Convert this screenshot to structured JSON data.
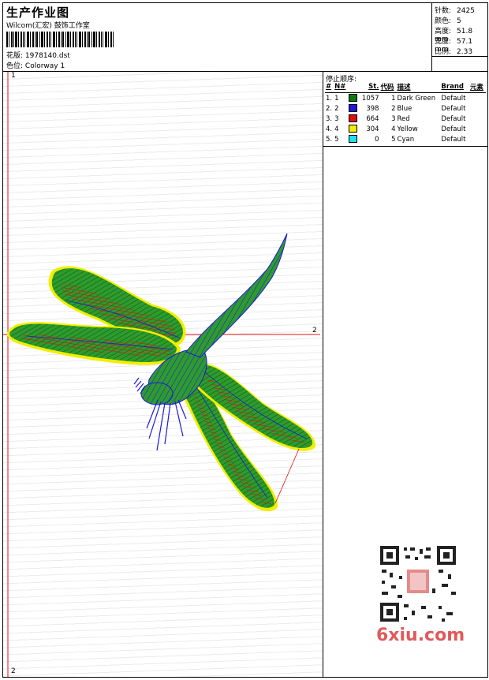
{
  "header": {
    "title": "生产作业图",
    "company": "Wilcom(汇宏) 鼓饰工作室",
    "design_label": "花版:",
    "design_value": "1978140.dst",
    "colorway_label": "色位:",
    "colorway_value": "Colorway 1"
  },
  "stats": {
    "stitches_label": "针数:",
    "stitches_value": "2425",
    "colors_label": "颜色:",
    "colors_value": "5",
    "height_label": "高度:",
    "height_value": "51.8 mm",
    "width_label": "宽度:",
    "width_value": "57.1 mm",
    "scale_label": "比例:",
    "scale_value": "2.33"
  },
  "stop_sequence": {
    "heading": "停止顺序:",
    "columns": [
      "#",
      "N#",
      "St.",
      "代码",
      "描述",
      "Brand",
      "元素"
    ],
    "rows": [
      {
        "num": "1.",
        "n": "1",
        "color": "#0c7a10",
        "st": "1057",
        "code": "1",
        "desc": "Dark Green",
        "brand": "Default"
      },
      {
        "num": "2.",
        "n": "2",
        "color": "#1a1ad8",
        "st": "398",
        "code": "2",
        "desc": "Blue",
        "brand": "Default"
      },
      {
        "num": "3.",
        "n": "3",
        "color": "#e01010",
        "st": "664",
        "code": "3",
        "desc": "Red",
        "brand": "Default"
      },
      {
        "num": "4.",
        "n": "4",
        "color": "#f2ee00",
        "st": "304",
        "code": "4",
        "desc": "Yellow",
        "brand": "Default"
      },
      {
        "num": "5.",
        "n": "5",
        "color": "#22e0e8",
        "st": "0",
        "code": "5",
        "desc": "Cyan",
        "brand": "Default"
      }
    ]
  },
  "axis_labels": {
    "top_left": "1",
    "right": "2",
    "bottom_left": "2"
  },
  "watermark": "6xiu.com"
}
